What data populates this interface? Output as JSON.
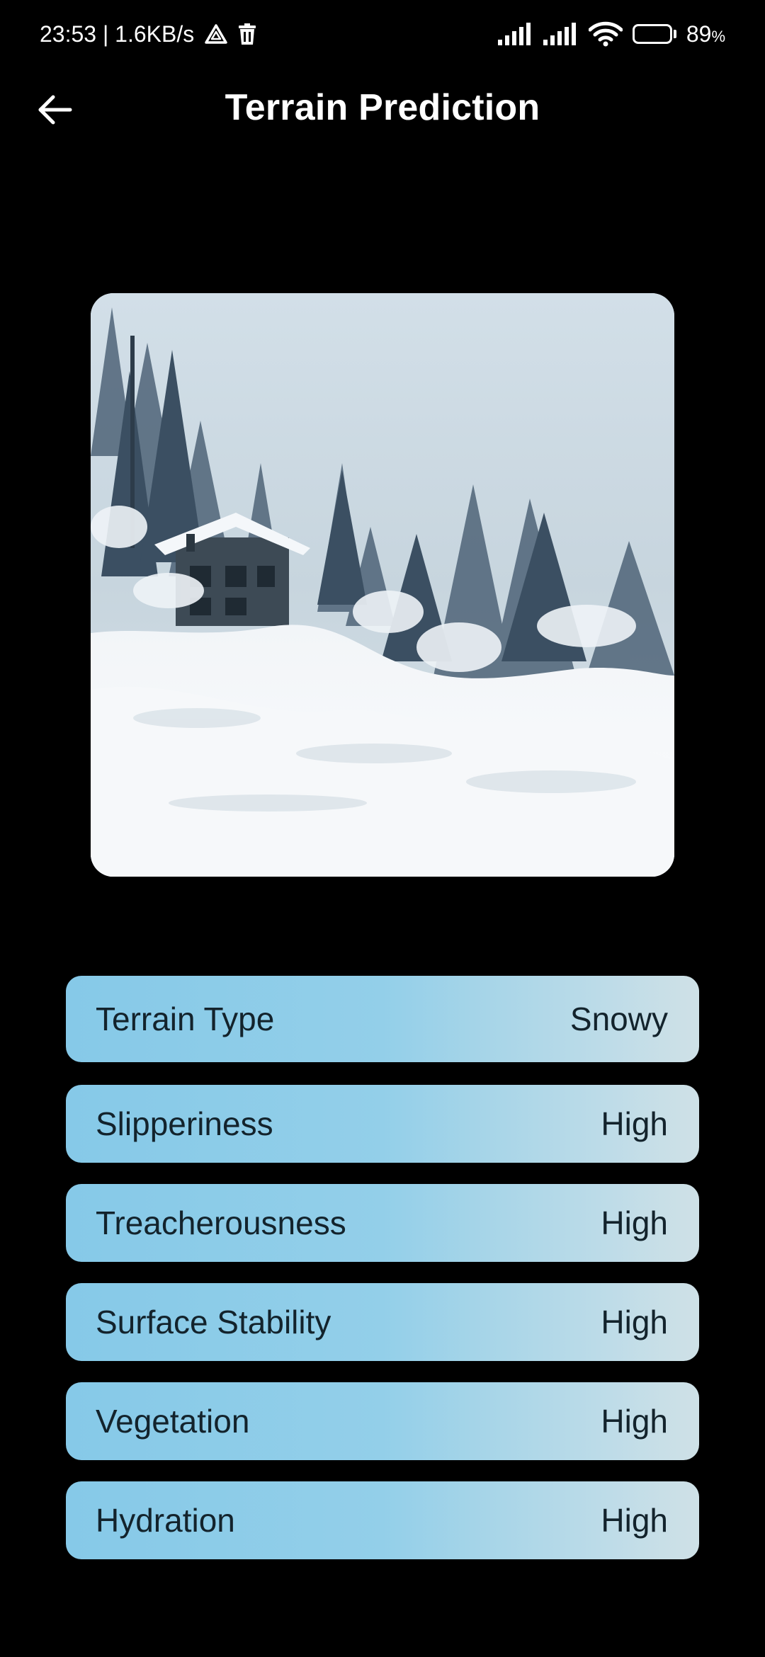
{
  "status_bar": {
    "time_speed": "23:53 | 1.6KB/s",
    "battery_percent": "89",
    "battery_unit": "%",
    "battery_level": 0.89,
    "icons": [
      "drive-icon",
      "trash-icon",
      "signal-icon",
      "signal-icon",
      "wifi-icon",
      "battery-icon"
    ]
  },
  "header": {
    "title": "Terrain Prediction",
    "back_icon": "arrow-left-icon"
  },
  "image": {
    "alt": "snowy cabin among pine trees"
  },
  "results": [
    {
      "label": "Terrain Type",
      "value": "Snowy"
    },
    {
      "label": "Slipperiness",
      "value": "High"
    },
    {
      "label": "Treacherousness",
      "value": "High"
    },
    {
      "label": "Surface Stability",
      "value": "High"
    },
    {
      "label": "Vegetation",
      "value": "High"
    },
    {
      "label": "Hydration",
      "value": "High"
    }
  ],
  "colors": {
    "background": "#000000",
    "card_gradient_start": "#86c9e8",
    "card_gradient_end": "#cfe1e7",
    "card_text": "#13232c"
  }
}
